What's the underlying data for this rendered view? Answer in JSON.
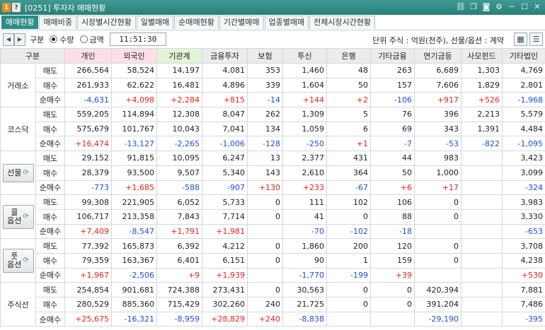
{
  "titlebar": {
    "badge1": "1",
    "badge2": "?",
    "title": "[0251] 투자자 매매현황",
    "icons": [
      "link-icon",
      "copy-icon",
      "camera-icon",
      "gear-icon",
      "minimize-icon",
      "maximize-icon",
      "close-icon"
    ],
    "icon_glyphs": [
      "⛓",
      "❐",
      "◙",
      "⚙",
      "─",
      "☐",
      "✕"
    ]
  },
  "tabs": [
    "매매현황",
    "매매비중",
    "시장별시간현황",
    "일별매매",
    "순매매현황",
    "기간별매매",
    "업종별매매",
    "전체시장시간현황"
  ],
  "active_tab": 0,
  "toolbar": {
    "group_label": "구분",
    "radio_qty": "수량",
    "radio_amount": "금액",
    "selected": "수량",
    "time": "11:51:30",
    "unit_text": "단위 주식 : 억원(천주), 선물/옵션 : 계약"
  },
  "columns": [
    "구분",
    "",
    "개인",
    "외국인",
    "기관계",
    "금융투자",
    "보험",
    "투신",
    "은행",
    "기타금융",
    "연기금등",
    "사모펀드",
    "기타법인"
  ],
  "row_labels": [
    "매도",
    "매수",
    "순매수"
  ],
  "groups": [
    {
      "name": "거래소",
      "button": false,
      "sell": [
        "266,564",
        "58,524",
        "14,197",
        "4,081",
        "353",
        "1,460",
        "48",
        "263",
        "6,689",
        "1,303",
        "4,769"
      ],
      "buy": [
        "261,933",
        "62,622",
        "16,481",
        "4,896",
        "339",
        "1,604",
        "50",
        "157",
        "7,606",
        "1,829",
        "2,801"
      ],
      "net": [
        "-4,631",
        "+4,098",
        "+2,284",
        "+815",
        "-14",
        "+144",
        "+2",
        "-106",
        "+917",
        "+526",
        "-1,968"
      ]
    },
    {
      "name": "코스닥",
      "button": false,
      "sell": [
        "559,205",
        "114,894",
        "12,308",
        "8,047",
        "262",
        "1,309",
        "5",
        "76",
        "396",
        "2,213",
        "5,579"
      ],
      "buy": [
        "575,679",
        "101,767",
        "10,043",
        "7,041",
        "134",
        "1,059",
        "6",
        "69",
        "343",
        "1,391",
        "4,484"
      ],
      "net": [
        "+16,474",
        "-13,127",
        "-2,265",
        "-1,006",
        "-128",
        "-250",
        "+1",
        "-7",
        "-53",
        "-822",
        "-1,095"
      ]
    },
    {
      "name": "선물",
      "button": true,
      "sell": [
        "29,152",
        "91,815",
        "10,095",
        "6,247",
        "13",
        "2,377",
        "431",
        "44",
        "983",
        "",
        "3,423"
      ],
      "buy": [
        "28,379",
        "93,500",
        "9,507",
        "5,340",
        "143",
        "2,610",
        "364",
        "50",
        "1,000",
        "",
        "3,099"
      ],
      "net": [
        "-773",
        "+1,685",
        "-588",
        "-907",
        "+130",
        "+233",
        "-67",
        "+6",
        "+17",
        "",
        "-324"
      ]
    },
    {
      "name": "콜\n옵션",
      "button": true,
      "sell": [
        "99,308",
        "221,905",
        "6,052",
        "5,733",
        "0",
        "111",
        "102",
        "106",
        "0",
        "",
        "3,983"
      ],
      "buy": [
        "106,717",
        "213,358",
        "7,843",
        "7,714",
        "0",
        "41",
        "0",
        "88",
        "0",
        "",
        "3,330"
      ],
      "net": [
        "+7,409",
        "-8,547",
        "+1,791",
        "+1,981",
        "",
        "-70",
        "-102",
        "-18",
        "",
        "",
        "-653"
      ]
    },
    {
      "name": "풋\n옵션",
      "button": true,
      "sell": [
        "77,392",
        "165,873",
        "6,392",
        "4,212",
        "0",
        "1,860",
        "200",
        "120",
        "0",
        "",
        "3,708"
      ],
      "buy": [
        "79,359",
        "163,367",
        "6,401",
        "6,151",
        "0",
        "90",
        "1",
        "159",
        "0",
        "",
        "4,238"
      ],
      "net": [
        "+1,967",
        "-2,506",
        "+9",
        "+1,939",
        "",
        "-1,770",
        "-199",
        "+39",
        "",
        "",
        "+530"
      ]
    },
    {
      "name": "주식선",
      "button": false,
      "sell": [
        "254,854",
        "901,681",
        "724,388",
        "273,431",
        "0",
        "30,563",
        "0",
        "0",
        "420,394",
        "",
        "7,881"
      ],
      "buy": [
        "280,529",
        "885,360",
        "715,429",
        "302,260",
        "240",
        "21,725",
        "0",
        "0",
        "391,204",
        "",
        "7,486"
      ],
      "net": [
        "+25,675",
        "-16,321",
        "-8,959",
        "+28,829",
        "+240",
        "-8,838",
        "",
        "",
        "-29,190",
        "",
        "-395"
      ]
    }
  ],
  "colors": {
    "title_bar": "#2a7f79",
    "active_tab": "#2c8d88",
    "positive": "#e8231a",
    "negative": "#1b4fd6",
    "header_pink": "#fce0e6",
    "header_green": "#e3f5d6"
  }
}
